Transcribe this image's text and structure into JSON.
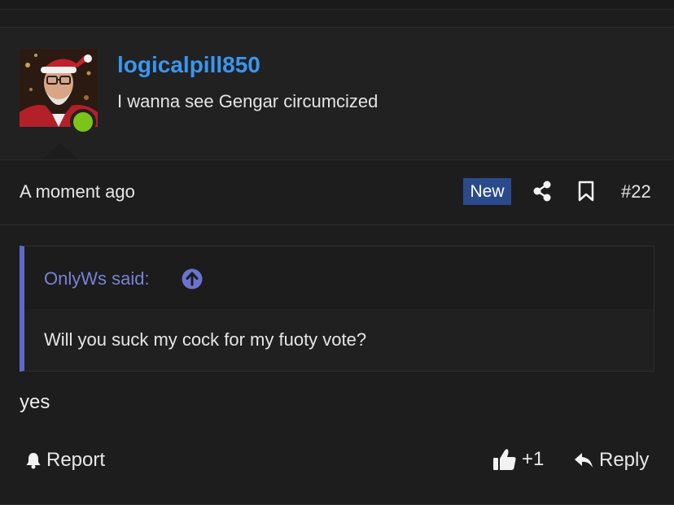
{
  "post": {
    "author": {
      "username": "logicalpill850",
      "user_title": "I wanna see Gengar circumcized",
      "avatar": "santa-avatar-image",
      "online_status_color": "#7cc31a"
    },
    "meta": {
      "timestamp": "A moment ago",
      "new_badge": "New",
      "post_number": "#22",
      "share_icon": "share-icon",
      "bookmark_icon": "bookmark-icon"
    },
    "quote": {
      "author_line": "OnlyWs said:",
      "jump_icon": "arrow-up-circle-icon",
      "text": "Will you suck my cock for my fuoty vote?"
    },
    "message": "yes",
    "actions": {
      "report_label": "Report",
      "like_label": "+1",
      "reply_label": "Reply"
    }
  },
  "colors": {
    "username": "#3a96f0",
    "quote_accent": "#6467c8",
    "new_badge_bg": "#2b4a8c"
  }
}
